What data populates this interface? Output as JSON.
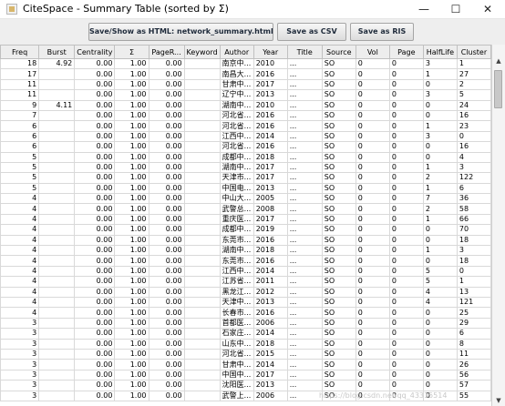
{
  "window": {
    "title": "CiteSpace - Summary Table (sorted by Σ)",
    "minimize": "—",
    "maximize": "☐",
    "close": "✕"
  },
  "toolbar": {
    "html_label": "Save/Show as HTML: network_summary.html",
    "csv_label": "Save as CSV",
    "ris_label": "Save as RIS"
  },
  "table": {
    "columns": [
      "Freq",
      "Burst",
      "Centrality",
      "Σ",
      "PageR...",
      "Keyword",
      "Author",
      "Year",
      "Title",
      "Source",
      "Vol",
      "Page",
      "HalfLife",
      "Cluster"
    ],
    "rows": [
      [
        "18",
        "4.92",
        "0.00",
        "1.00",
        "0.00",
        "",
        "南京中...",
        "2010",
        "...",
        "SO",
        "0",
        "0",
        "3",
        "1"
      ],
      [
        "17",
        "",
        "0.00",
        "1.00",
        "0.00",
        "",
        "南昌大...",
        "2016",
        "...",
        "SO",
        "0",
        "0",
        "1",
        "27"
      ],
      [
        "11",
        "",
        "0.00",
        "1.00",
        "0.00",
        "",
        "甘肃中...",
        "2017",
        "...",
        "SO",
        "0",
        "0",
        "0",
        "2"
      ],
      [
        "11",
        "",
        "0.00",
        "1.00",
        "0.00",
        "",
        "辽宁中...",
        "2013",
        "...",
        "SO",
        "0",
        "0",
        "3",
        "5"
      ],
      [
        "9",
        "4.11",
        "0.00",
        "1.00",
        "0.00",
        "",
        "湖南中...",
        "2010",
        "...",
        "SO",
        "0",
        "0",
        "0",
        "24"
      ],
      [
        "7",
        "",
        "0.00",
        "1.00",
        "0.00",
        "",
        "河北省...",
        "2016",
        "...",
        "SO",
        "0",
        "0",
        "0",
        "16"
      ],
      [
        "6",
        "",
        "0.00",
        "1.00",
        "0.00",
        "",
        "河北省...",
        "2016",
        "...",
        "SO",
        "0",
        "0",
        "1",
        "23"
      ],
      [
        "6",
        "",
        "0.00",
        "1.00",
        "0.00",
        "",
        "江西中...",
        "2014",
        "...",
        "SO",
        "0",
        "0",
        "3",
        "0"
      ],
      [
        "6",
        "",
        "0.00",
        "1.00",
        "0.00",
        "",
        "河北省...",
        "2016",
        "...",
        "SO",
        "0",
        "0",
        "0",
        "16"
      ],
      [
        "5",
        "",
        "0.00",
        "1.00",
        "0.00",
        "",
        "成都中...",
        "2018",
        "...",
        "SO",
        "0",
        "0",
        "0",
        "4"
      ],
      [
        "5",
        "",
        "0.00",
        "1.00",
        "0.00",
        "",
        "湖南中...",
        "2017",
        "...",
        "SO",
        "0",
        "0",
        "1",
        "3"
      ],
      [
        "5",
        "",
        "0.00",
        "1.00",
        "0.00",
        "",
        "天津市...",
        "2017",
        "...",
        "SO",
        "0",
        "0",
        "2",
        "122"
      ],
      [
        "5",
        "",
        "0.00",
        "1.00",
        "0.00",
        "",
        "中国电...",
        "2013",
        "...",
        "SO",
        "0",
        "0",
        "1",
        "6"
      ],
      [
        "4",
        "",
        "0.00",
        "1.00",
        "0.00",
        "",
        "中山大...",
        "2005",
        "...",
        "SO",
        "0",
        "0",
        "7",
        "36"
      ],
      [
        "4",
        "",
        "0.00",
        "1.00",
        "0.00",
        "",
        "武警总...",
        "2008",
        "...",
        "SO",
        "0",
        "0",
        "2",
        "58"
      ],
      [
        "4",
        "",
        "0.00",
        "1.00",
        "0.00",
        "",
        "重庆医...",
        "2017",
        "...",
        "SO",
        "0",
        "0",
        "1",
        "66"
      ],
      [
        "4",
        "",
        "0.00",
        "1.00",
        "0.00",
        "",
        "成都中...",
        "2019",
        "...",
        "SO",
        "0",
        "0",
        "0",
        "70"
      ],
      [
        "4",
        "",
        "0.00",
        "1.00",
        "0.00",
        "",
        "东莞市...",
        "2016",
        "...",
        "SO",
        "0",
        "0",
        "0",
        "18"
      ],
      [
        "4",
        "",
        "0.00",
        "1.00",
        "0.00",
        "",
        "湖南中...",
        "2018",
        "...",
        "SO",
        "0",
        "0",
        "1",
        "3"
      ],
      [
        "4",
        "",
        "0.00",
        "1.00",
        "0.00",
        "",
        "东莞市...",
        "2016",
        "...",
        "SO",
        "0",
        "0",
        "0",
        "18"
      ],
      [
        "4",
        "",
        "0.00",
        "1.00",
        "0.00",
        "",
        "江西中...",
        "2014",
        "...",
        "SO",
        "0",
        "0",
        "5",
        "0"
      ],
      [
        "4",
        "",
        "0.00",
        "1.00",
        "0.00",
        "",
        "江苏省...",
        "2011",
        "...",
        "SO",
        "0",
        "0",
        "5",
        "1"
      ],
      [
        "4",
        "",
        "0.00",
        "1.00",
        "0.00",
        "",
        "黑龙江...",
        "2012",
        "...",
        "SO",
        "0",
        "0",
        "4",
        "13"
      ],
      [
        "4",
        "",
        "0.00",
        "1.00",
        "0.00",
        "",
        "天津中...",
        "2013",
        "...",
        "SO",
        "0",
        "0",
        "4",
        "121"
      ],
      [
        "4",
        "",
        "0.00",
        "1.00",
        "0.00",
        "",
        "长春市...",
        "2016",
        "...",
        "SO",
        "0",
        "0",
        "0",
        "25"
      ],
      [
        "3",
        "",
        "0.00",
        "1.00",
        "0.00",
        "",
        "首都医...",
        "2006",
        "...",
        "SO",
        "0",
        "0",
        "0",
        "29"
      ],
      [
        "3",
        "",
        "0.00",
        "1.00",
        "0.00",
        "",
        "石家庄...",
        "2014",
        "...",
        "SO",
        "0",
        "0",
        "0",
        "6"
      ],
      [
        "3",
        "",
        "0.00",
        "1.00",
        "0.00",
        "",
        "山东中...",
        "2018",
        "...",
        "SO",
        "0",
        "0",
        "0",
        "8"
      ],
      [
        "3",
        "",
        "0.00",
        "1.00",
        "0.00",
        "",
        "河北省...",
        "2015",
        "...",
        "SO",
        "0",
        "0",
        "0",
        "11"
      ],
      [
        "3",
        "",
        "0.00",
        "1.00",
        "0.00",
        "",
        "甘肃中...",
        "2014",
        "...",
        "SO",
        "0",
        "0",
        "0",
        "26"
      ],
      [
        "3",
        "",
        "0.00",
        "1.00",
        "0.00",
        "",
        "中国中...",
        "2017",
        "...",
        "SO",
        "0",
        "0",
        "0",
        "56"
      ],
      [
        "3",
        "",
        "0.00",
        "1.00",
        "0.00",
        "",
        "沈阳医...",
        "2013",
        "...",
        "SO",
        "0",
        "0",
        "0",
        "57"
      ],
      [
        "3",
        "",
        "0.00",
        "1.00",
        "0.00",
        "",
        "武警上...",
        "2006",
        "...",
        "SO",
        "0",
        "0",
        "0",
        "55"
      ]
    ]
  },
  "scrollbar": {
    "up_arrow": "▲",
    "down_arrow": "▼"
  },
  "watermark": "https://blog.csdn.net/qq_43315514",
  "colors": {
    "header_bg": "#ededed",
    "grid": "#d9d9d9",
    "toolbar_bg": "#eeeeee"
  }
}
